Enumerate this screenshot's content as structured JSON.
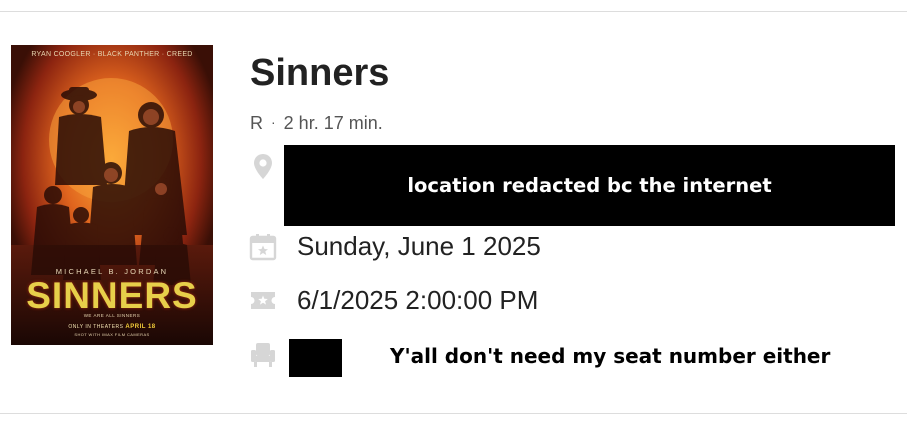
{
  "movie": {
    "title": "Sinners",
    "rating": "R",
    "separator": "·",
    "runtime": "2 hr. 17 min."
  },
  "poster": {
    "credit": "RYAN COOGLER · BLACK PANTHER · CREED",
    "actor": "MICHAEL B. JORDAN",
    "title": "SINNERS",
    "tagline": "WE ARE ALL SINNERS",
    "release_prefix": "ONLY IN THEATERS",
    "release_date": "APRIL 18",
    "format_line": "SHOT WITH IMAX FILM CAMERAS"
  },
  "details": {
    "location_icon": "map-pin-icon",
    "location_redaction_text": "location redacted bc the internet",
    "date_icon": "calendar-star-icon",
    "date": "Sunday, June 1 2025",
    "showtime_icon": "ticket-icon",
    "showtime": "6/1/2025 2:00:00 PM",
    "seat_icon": "seat-icon",
    "seat_note": "Y'all don't need my seat number either"
  },
  "colors": {
    "title": "#222222",
    "meta": "#555555",
    "icon": "#d6d6d6",
    "redaction": "#000000",
    "divider": "#dddddd"
  }
}
